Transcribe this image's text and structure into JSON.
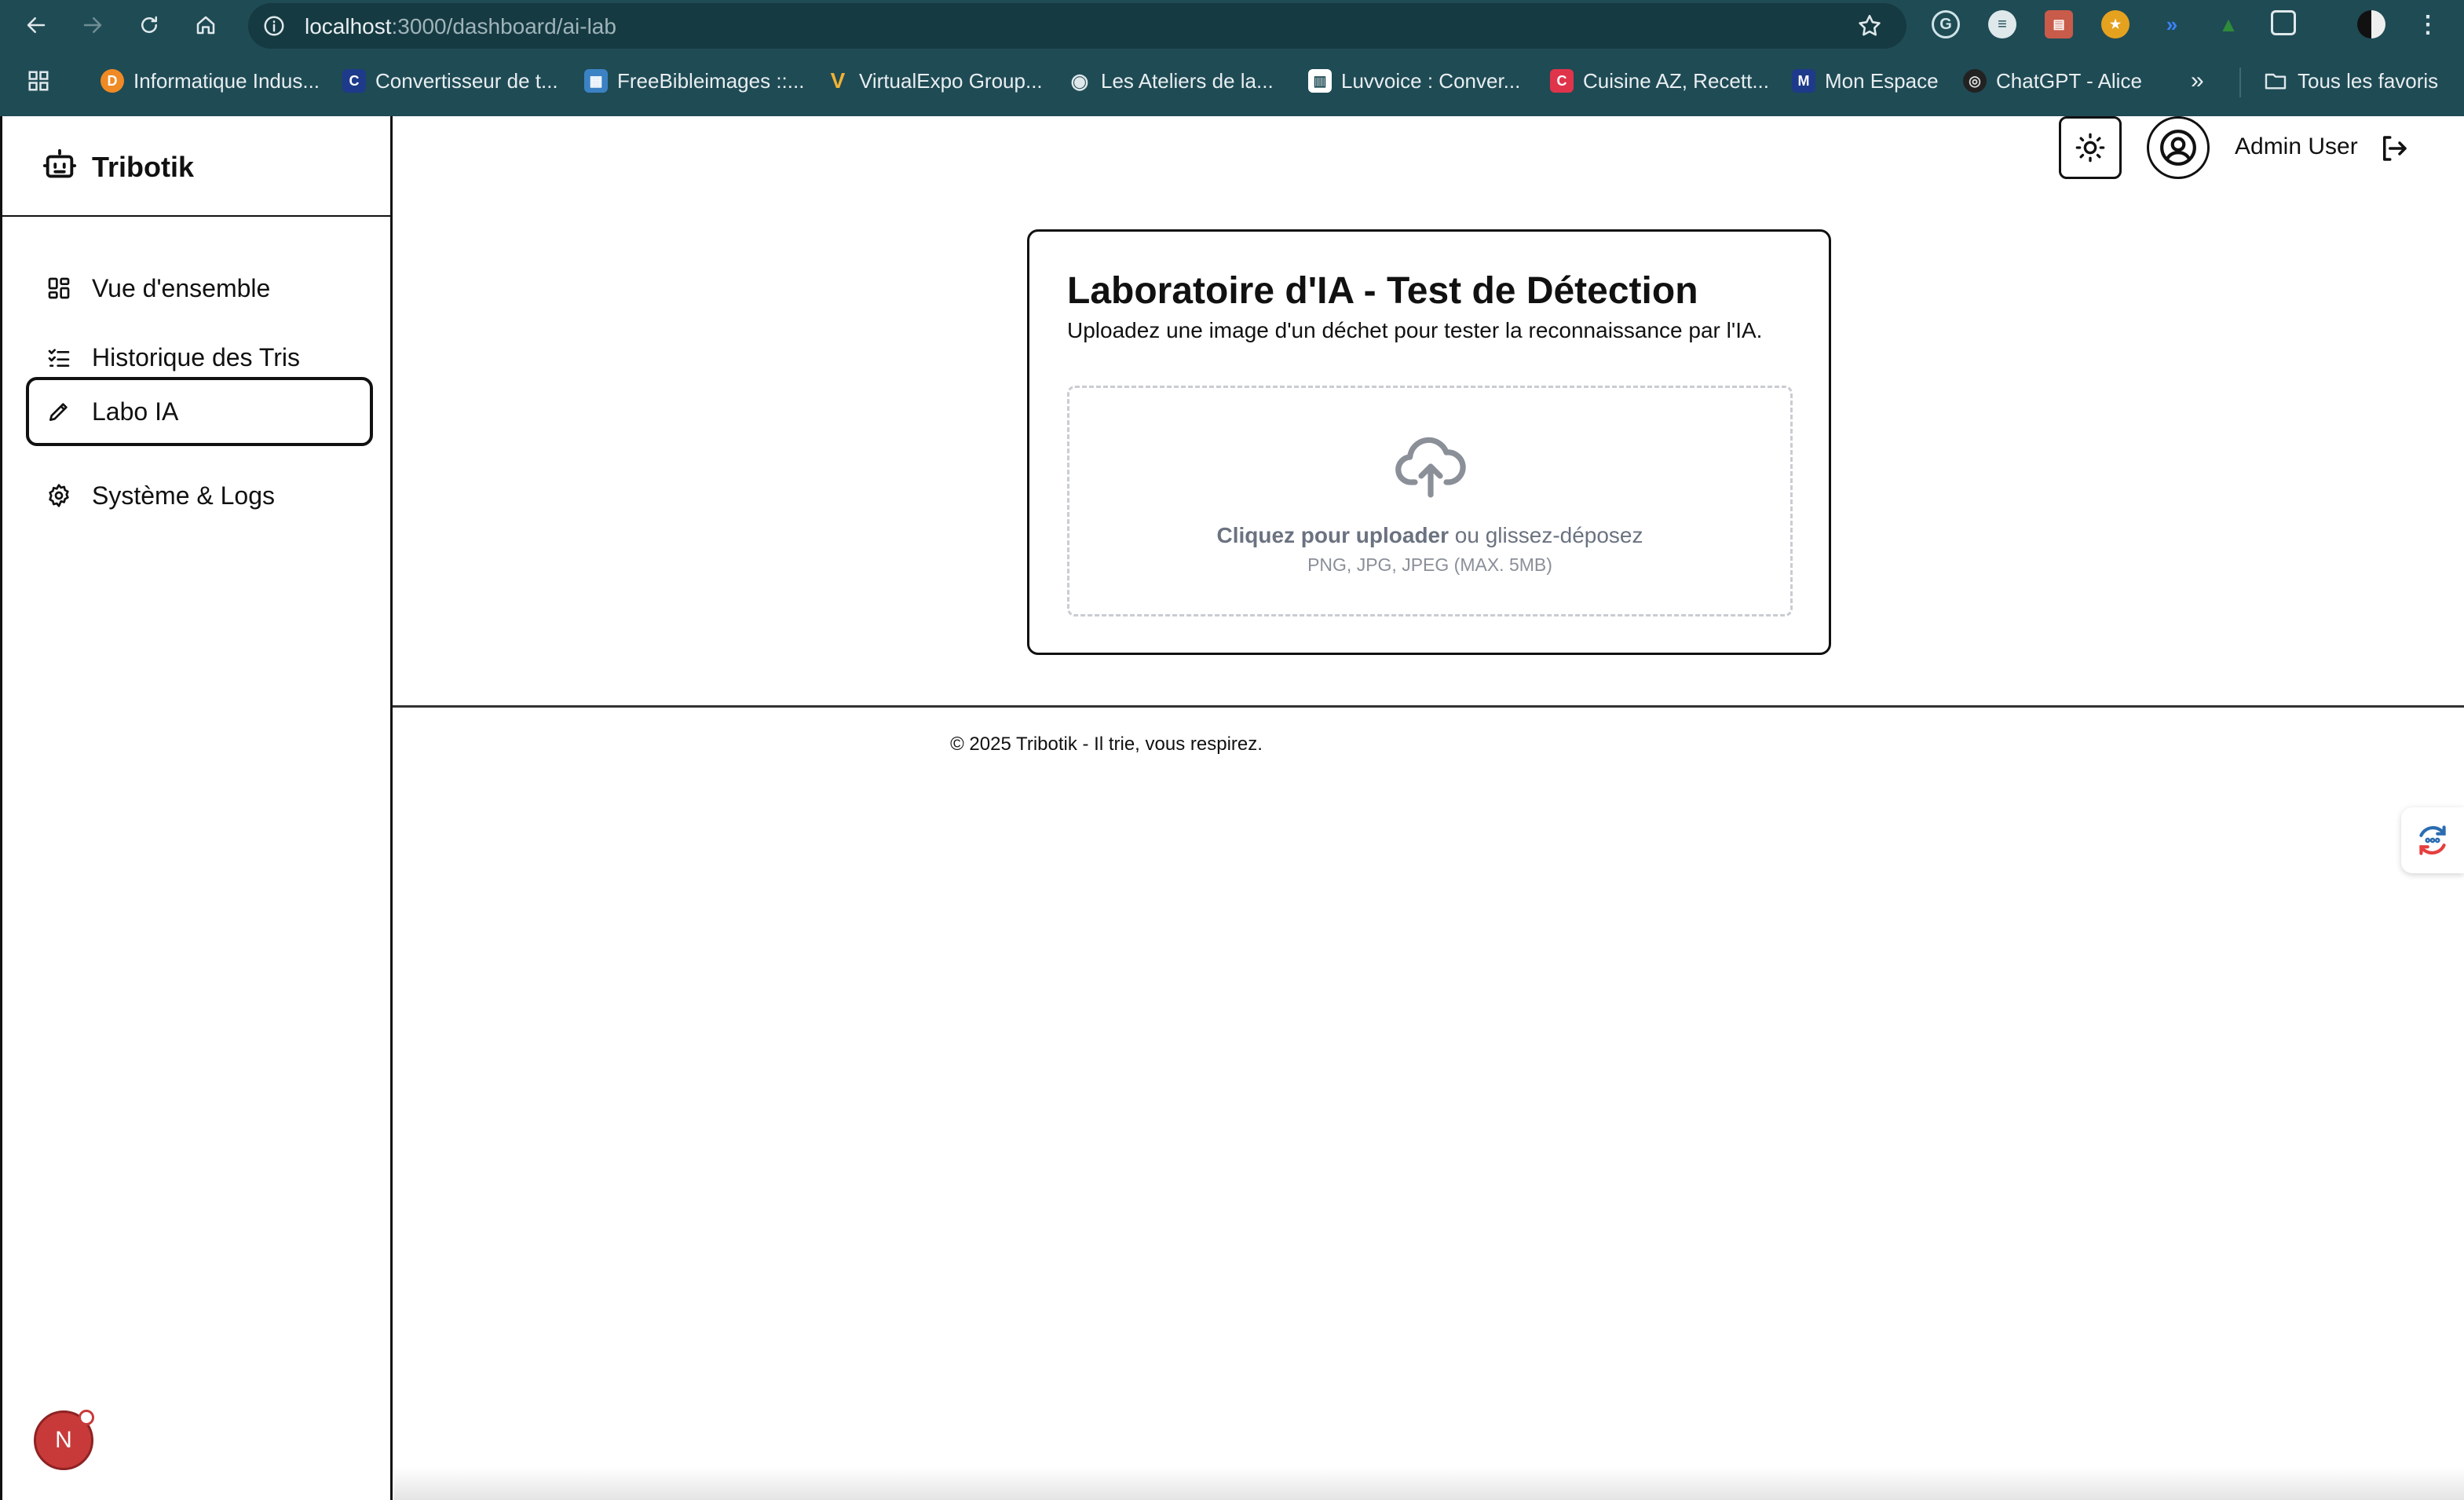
{
  "browser": {
    "url_host": "localhost",
    "url_path": ":3000/dashboard/ai-lab",
    "bookmarks": [
      {
        "label": "Informatique Indus...",
        "color": "#f08a24",
        "glyph": "D"
      },
      {
        "label": "Convertisseur de t...",
        "color": "#1e3a8a",
        "glyph": "C"
      },
      {
        "label": "FreeBibleimages ::...",
        "color": "#3b82c4",
        "glyph": "▦"
      },
      {
        "label": "VirtualExpo Group...",
        "color": "#1f4b55",
        "glyph": "V"
      },
      {
        "label": "Les Ateliers de la...",
        "color": "#5b6b70",
        "glyph": "◉"
      },
      {
        "label": "Luvvoice : Conver...",
        "color": "#ffffff",
        "glyph": "▥"
      },
      {
        "label": "Cuisine AZ, Recett...",
        "color": "#e0344b",
        "glyph": "C"
      },
      {
        "label": "Mon Espace",
        "color": "#1e3a8a",
        "glyph": "M"
      },
      {
        "label": "ChatGPT - Alice",
        "color": "#222222",
        "glyph": "◎"
      }
    ],
    "all_bookmarks_label": "Tous les favoris"
  },
  "sidebar": {
    "brand": "Tribotik",
    "items": [
      {
        "label": "Vue d'ensemble",
        "icon": "grid-icon",
        "active": false
      },
      {
        "label": "Historique des Tris",
        "icon": "list-check-icon",
        "active": false
      },
      {
        "label": "Labo IA",
        "icon": "pencil-icon",
        "active": true
      },
      {
        "label": "Système & Logs",
        "icon": "gear-icon",
        "active": false
      }
    ],
    "avatar_letter": "N"
  },
  "header": {
    "user_name": "Admin User"
  },
  "card": {
    "title": "Laboratoire d'IA - Test de Détection",
    "subtitle": "Uploadez une image d'un déchet pour tester la reconnaissance par l'IA.",
    "dropzone": {
      "cta_bold": "Cliquez pour uploader",
      "cta_rest": " ou glissez-déposez",
      "formats": "PNG, JPG, JPEG (MAX. 5MB)"
    }
  },
  "footer": {
    "text": "© 2025 Tribotik - Il trie, vous respirez."
  },
  "colors": {
    "chrome": "#1f4b55",
    "omnibox": "#163a42",
    "accent_dark": "#111111",
    "muted_text": "#6b7280"
  }
}
